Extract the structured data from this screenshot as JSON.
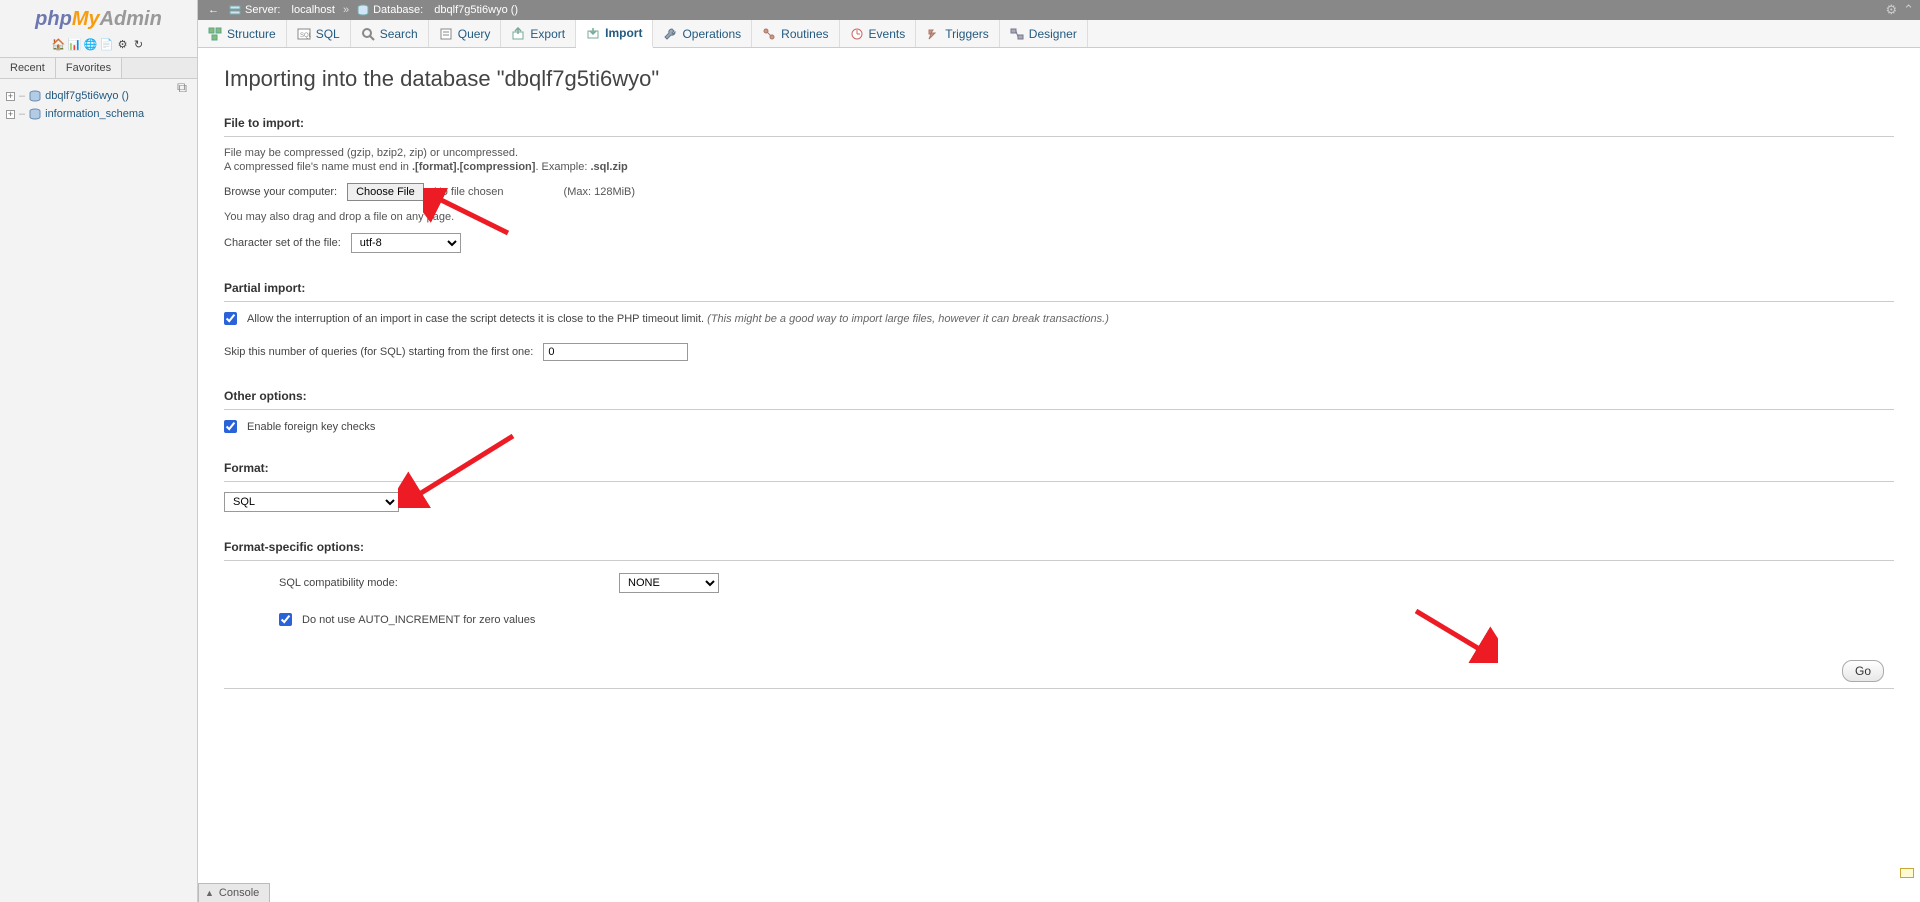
{
  "logo": {
    "php": "php",
    "my": "My",
    "admin": "Admin"
  },
  "sidebar": {
    "tabs": {
      "recent": "Recent",
      "favorites": "Favorites"
    },
    "dbs": [
      {
        "name": "dbqlf7g5ti6wyo ()"
      },
      {
        "name": "information_schema"
      }
    ]
  },
  "breadcrumb": {
    "server_label": "Server:",
    "server_name": "localhost",
    "db_label": "Database:",
    "db_name": "dbqlf7g5ti6wyo ()"
  },
  "navtabs": [
    {
      "label": "Structure"
    },
    {
      "label": "SQL"
    },
    {
      "label": "Search"
    },
    {
      "label": "Query"
    },
    {
      "label": "Export"
    },
    {
      "label": "Import",
      "active": true
    },
    {
      "label": "Operations"
    },
    {
      "label": "Routines"
    },
    {
      "label": "Events"
    },
    {
      "label": "Triggers"
    },
    {
      "label": "Designer"
    }
  ],
  "page": {
    "title": "Importing into the database \"dbqlf7g5ti6wyo\"",
    "file_to_import": "File to import:",
    "compress_help": "File may be compressed (gzip, bzip2, zip) or uncompressed.",
    "compress_name_a": "A compressed file's name must end in ",
    "compress_name_b": ".[format].[compression]",
    "compress_name_c": ". Example: ",
    "compress_name_d": ".sql.zip",
    "browse_label": "Browse your computer:",
    "choose_file": "Choose File",
    "no_file": "No file chosen",
    "max_size": "(Max: 128MiB)",
    "drag_help": "You may also drag and drop a file on any page.",
    "charset_label": "Character set of the file:",
    "charset_value": "utf-8",
    "partial_import": "Partial import:",
    "allow_interrupt": "Allow the interruption of an import in case the script detects it is close to the PHP timeout limit. ",
    "allow_interrupt_hint": "(This might be a good way to import large files, however it can break transactions.)",
    "skip_label": "Skip this number of queries (for SQL) starting from the first one:",
    "skip_value": "0",
    "other_options": "Other options:",
    "enable_fk": "Enable foreign key checks",
    "format": "Format:",
    "format_value": "SQL",
    "format_specific": "Format-specific options:",
    "compat_label": "SQL compatibility mode:",
    "compat_value": "NONE",
    "no_auto_a": "Do not use ",
    "no_auto_b": "AUTO_INCREMENT",
    "no_auto_c": " for zero values",
    "go": "Go",
    "console": "Console"
  }
}
